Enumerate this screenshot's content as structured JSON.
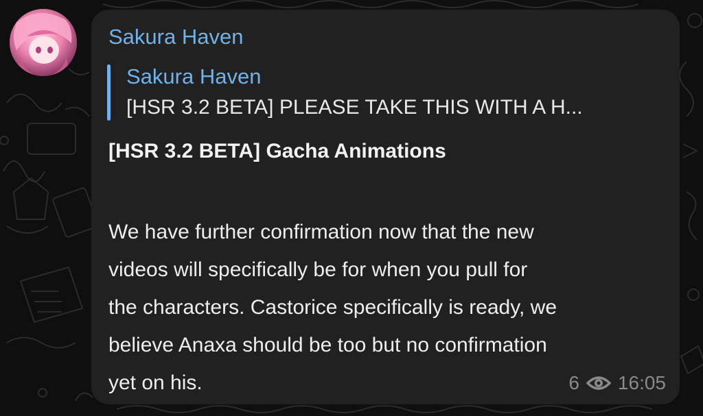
{
  "message": {
    "sender": "Sakura Haven",
    "reply": {
      "author": "Sakura Haven",
      "preview": "[HSR 3.2 BETA] PLEASE TAKE THIS WITH A H..."
    },
    "title": "[HSR 3.2 BETA] Gacha Animations",
    "body_lines": [
      "We have further confirmation now that the new",
      "videos will specifically be for when you pull for",
      "the characters. Castorice specifically is ready, we",
      "believe Anaxa should be too but no confirmation",
      "yet on his."
    ],
    "views": "6",
    "time": "16:05"
  },
  "icons": {
    "avatar": "channel-avatar",
    "views": "eye-icon"
  },
  "colors": {
    "background": "#0f0f0f",
    "bubble": "#212121",
    "accent": "#6fb2ec",
    "meta": "#8a8a8a",
    "text": "#eeeeee"
  }
}
